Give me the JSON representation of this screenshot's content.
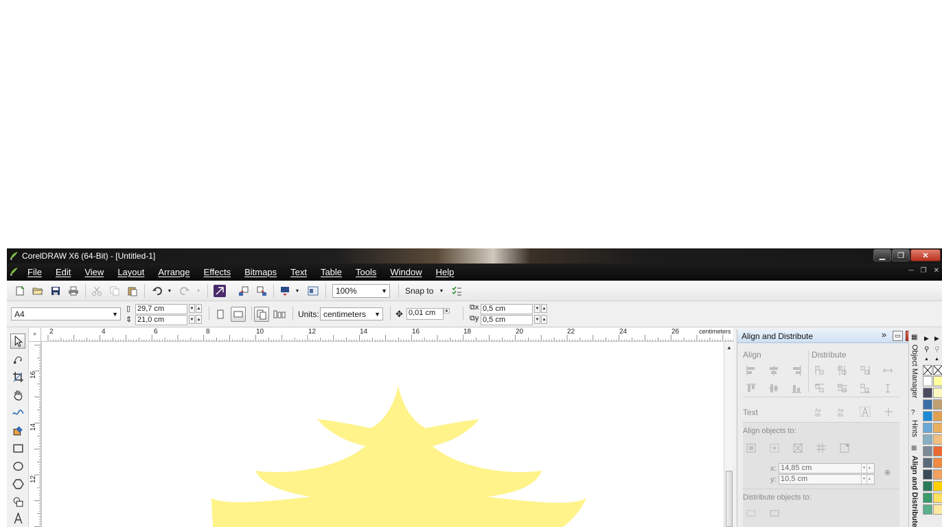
{
  "window": {
    "title": "CorelDRAW X6 (64-Bit) - [Untitled-1]",
    "minimize": "▁",
    "maximize": "❐",
    "close": "✕"
  },
  "menu": {
    "items": [
      "File",
      "Edit",
      "View",
      "Layout",
      "Arrange",
      "Effects",
      "Bitmaps",
      "Text",
      "Table",
      "Tools",
      "Window",
      "Help"
    ]
  },
  "toolbar": {
    "zoom": "100%",
    "snap_to": "Snap to"
  },
  "property_bar": {
    "page_size": "A4",
    "width": "29,7 cm",
    "height": "21,0 cm",
    "units_label": "Units:",
    "units_value": "centimeters",
    "nudge": "0,01 cm",
    "duplicate_x": "0,5 cm",
    "duplicate_y": "0,5 cm"
  },
  "rulers": {
    "horizontal_ticks": [
      "2",
      "4",
      "6",
      "8",
      "10",
      "12",
      "14",
      "16",
      "18",
      "20",
      "22",
      "24",
      "26"
    ],
    "units": "centimeters",
    "vertical_ticks": [
      "16",
      "14",
      "12"
    ]
  },
  "docker": {
    "title": "Align and Distribute",
    "expand": "»",
    "align_label": "Align",
    "distribute_label": "Distribute",
    "text_label": "Text",
    "align_objects_to_label": "Align objects to:",
    "x_label": "x:",
    "x_value": "14,85 cm",
    "y_label": "y:",
    "y_value": "10,5 cm",
    "distribute_objects_to_label": "Distribute objects to:",
    "collapse_arrow": "▲"
  },
  "docker_tabs": [
    "Object Manager",
    "Hints",
    "Align and Distribute"
  ],
  "colors": {
    "title_bar": "#161616",
    "menu_bar": "#101010",
    "docker_header": "#cfe0f3",
    "shape_fill": "#fff38a",
    "palette": [
      "#ffffff",
      "#4a4a60",
      "#3a6ea5",
      "#1e8ad6",
      "#6aa8d8",
      "#8ab0c4",
      "#7a8a96",
      "#5a6a78",
      "#3a4a56",
      "#2a7a5a",
      "#3a9a6a",
      "#5ab08a",
      "#ffffa0",
      "#fff8c0",
      "#c0a070",
      "#e0a050",
      "#e8b060",
      "#f0c080",
      "#e86a30",
      "#f08a40",
      "#f4a060",
      "#ffd000",
      "#ffe060",
      "#ffe8a0"
    ]
  }
}
